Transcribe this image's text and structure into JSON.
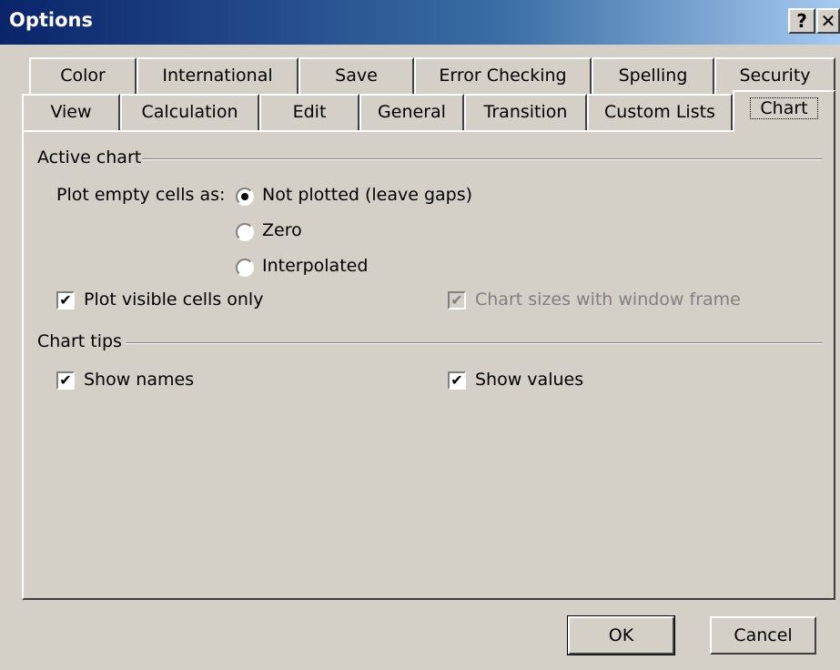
{
  "window": {
    "title": "Options",
    "help_label": "?",
    "close_label": "✕"
  },
  "tabs_row1": [
    "Color",
    "International",
    "Save",
    "Error Checking",
    "Spelling",
    "Security"
  ],
  "tabs_row2": [
    "View",
    "Calculation",
    "Edit",
    "General",
    "Transition",
    "Custom Lists",
    "Chart"
  ],
  "active_tab": "Chart",
  "active_chart": {
    "heading": "Active chart",
    "plot_empty_label": "Plot empty cells as:",
    "options": [
      {
        "label": "Not plotted (leave gaps)",
        "selected": true
      },
      {
        "label": "Zero",
        "selected": false
      },
      {
        "label": "Interpolated",
        "selected": false
      }
    ],
    "plot_visible": {
      "label": "Plot visible cells only",
      "checked": true
    },
    "chart_sizes": {
      "label": "Chart sizes with window frame",
      "checked": true,
      "disabled": true
    }
  },
  "chart_tips": {
    "heading": "Chart tips",
    "show_names": {
      "label": "Show names",
      "checked": true
    },
    "show_values": {
      "label": "Show values",
      "checked": true
    }
  },
  "buttons": {
    "ok": "OK",
    "cancel": "Cancel"
  }
}
